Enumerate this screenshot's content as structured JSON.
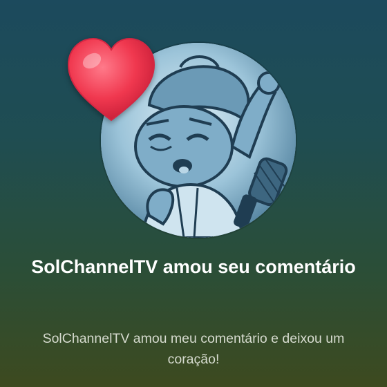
{
  "notification": {
    "title": "SolChannelTV amou seu comentário",
    "message": "SolChannelTV amou meu comentário e deixou um coração!"
  },
  "icons": {
    "avatar": "channel-avatar",
    "heart": "heart-icon"
  },
  "colors": {
    "heart": "#f0384f",
    "avatar_tint": "#7fb1cc",
    "title_text": "#ffffff",
    "subtitle_text": "#d6dbcf"
  }
}
